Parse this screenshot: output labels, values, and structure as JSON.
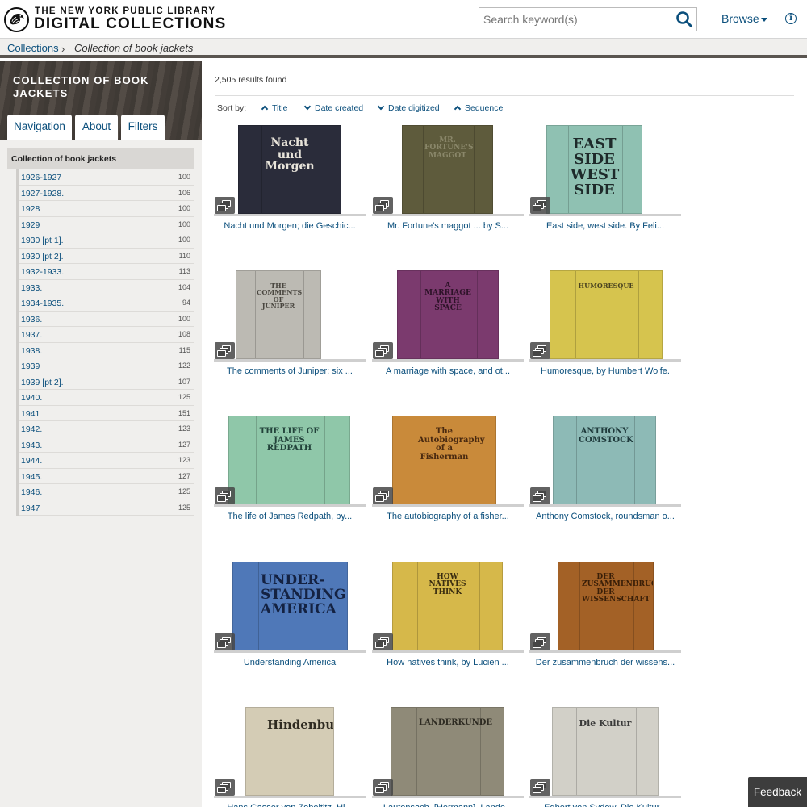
{
  "header": {
    "org": "THE NEW YORK PUBLIC LIBRARY",
    "site": "DIGITAL COLLECTIONS",
    "search_placeholder": "Search keyword(s)",
    "browse_label": "Browse"
  },
  "breadcrumb": {
    "root": "Collections",
    "current": "Collection of book jackets"
  },
  "sidebar": {
    "title": "COLLECTION OF BOOK JACKETS",
    "tabs": [
      "Navigation",
      "About",
      "Filters"
    ],
    "collection_heading": "Collection of book jackets",
    "years": [
      {
        "label": "1926-1927",
        "count": "100"
      },
      {
        "label": "1927-1928.",
        "count": "106"
      },
      {
        "label": "1928",
        "count": "100"
      },
      {
        "label": "1929",
        "count": "100"
      },
      {
        "label": "1930 [pt 1].",
        "count": "100"
      },
      {
        "label": "1930 [pt 2].",
        "count": "110"
      },
      {
        "label": "1932-1933.",
        "count": "113"
      },
      {
        "label": "1933.",
        "count": "104"
      },
      {
        "label": "1934-1935.",
        "count": "94"
      },
      {
        "label": "1936.",
        "count": "100"
      },
      {
        "label": "1937.",
        "count": "108"
      },
      {
        "label": "1938.",
        "count": "115"
      },
      {
        "label": "1939",
        "count": "122"
      },
      {
        "label": "1939 [pt 2].",
        "count": "107"
      },
      {
        "label": "1940.",
        "count": "125"
      },
      {
        "label": "1941",
        "count": "151"
      },
      {
        "label": "1942.",
        "count": "123"
      },
      {
        "label": "1943.",
        "count": "127"
      },
      {
        "label": "1944.",
        "count": "123"
      },
      {
        "label": "1945.",
        "count": "127"
      },
      {
        "label": "1946.",
        "count": "125"
      },
      {
        "label": "1947",
        "count": "125"
      }
    ]
  },
  "results": {
    "count_text": "2,505 results found",
    "sort_label": "Sort by:",
    "sort_options": [
      "Title",
      "Date created",
      "Date digitized",
      "Sequence"
    ],
    "items": [
      {
        "title": "Nacht und Morgen; die Geschichte eines Ausgewiesenen, von Karl Aschenbrenner",
        "cover_text": "Nacht und Morgen",
        "color": "#2a2c3a",
        "text_color": "#e8e4da"
      },
      {
        "title": "Mr. Fortune's maggot ... by Sylvia Townsend Warner",
        "cover_text": "MR. FORTUNE'S MAGGOT",
        "color": "#5e5b3c",
        "text_color": "#8a876a"
      },
      {
        "title": "East side, west side. By Felix Riesenberg",
        "cover_text": "EAST SIDE WEST SIDE",
        "color": "#8fc1b2",
        "text_color": "#1e2a2a"
      },
      {
        "title": "The comments of Juniper; six plays",
        "cover_text": "THE COMMENTS OF JUNIPER",
        "color": "#bcbab3",
        "text_color": "#4a4740"
      },
      {
        "title": "A marriage with space, and other poems",
        "cover_text": "A MARRIAGE WITH SPACE",
        "color": "#7b3a6e",
        "text_color": "#2d1228"
      },
      {
        "title": "Humoresque, by Humbert Wolfe.",
        "cover_text": "HUMORESQUE",
        "color": "#d6c44e",
        "text_color": "#4a4320"
      },
      {
        "title": "The life of James Redpath, by Charles F. Horner",
        "cover_text": "THE LIFE OF JAMES REDPATH",
        "color": "#8fc7a9",
        "text_color": "#22423a"
      },
      {
        "title": "The autobiography of a fisherman",
        "cover_text": "The Autobiography of a Fisherman",
        "color": "#c98a3a",
        "text_color": "#4a2a10"
      },
      {
        "title": "Anthony Comstock, roundsman of the Lord",
        "cover_text": "ANTHONY COMSTOCK",
        "color": "#8dbab6",
        "text_color": "#1f3a3c"
      },
      {
        "title": "Understanding America",
        "cover_text": "UNDER-STANDING AMERICA",
        "color": "#4f78b8",
        "text_color": "#142242"
      },
      {
        "title": "How natives think, by Lucien Lévy-Bruhl",
        "cover_text": "HOW NATIVES THINK",
        "color": "#d6b84a",
        "text_color": "#3a2d10"
      },
      {
        "title": "Der zusammenbruch der wissenschaft",
        "cover_text": "DER ZUSAMMENBRUCH DER WISSENSCHAFT",
        "color": "#a36126",
        "text_color": "#3a1f08"
      },
      {
        "title": "Hans Gasser von Zobeltitz, Hindenburg",
        "cover_text": "Hindenburg",
        "color": "#d4ccb5",
        "text_color": "#2e2a20"
      },
      {
        "title": "Lautensach, [Hermann], Landerkunde",
        "cover_text": "LANDERKUNDE",
        "color": "#8f8a78",
        "text_color": "#2e2b22"
      },
      {
        "title": "Egbert von Sydow, Die Kultur",
        "cover_text": "Die Kultur",
        "color": "#d2d0c8",
        "text_color": "#3a3a3a"
      }
    ],
    "truncated_titles": [
      "Nacht und Morgen; die Geschic...",
      "Mr. Fortune's maggot ... by S...",
      "East side, west side. By Feli...",
      "The comments of Juniper; six ...",
      "A marriage with space, and ot...",
      "Humoresque, by Humbert Wolfe.",
      "The life of James Redpath, by...",
      "The autobiography of a fisher...",
      "Anthony Comstock, roundsman o...",
      "Understanding America",
      "How natives think, by Lucien ...",
      "Der zusammenbruch der wissens...",
      "Hans Gasser von Zobeltitz, Hi...",
      "Lautensach, [Hermann], Lande...",
      "Egbert von Sydow, Die Kultur..."
    ]
  },
  "feedback_label": "Feedback"
}
